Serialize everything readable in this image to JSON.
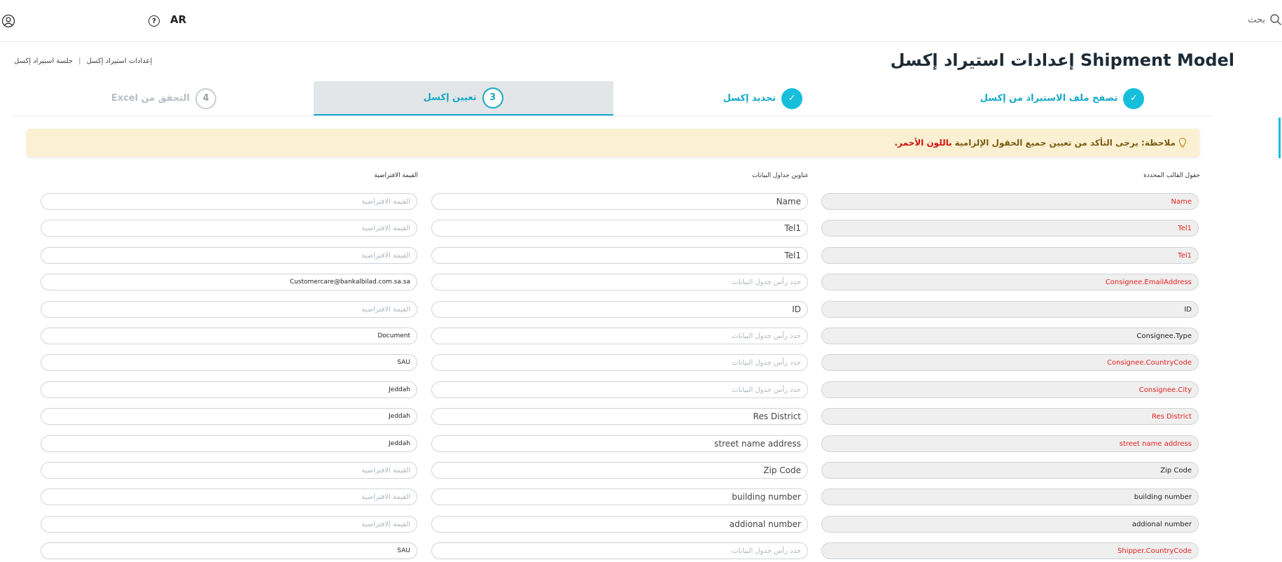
{
  "topbar": {
    "language": "AR",
    "help_glyph": "?",
    "search_label": "بحث",
    "icons": {
      "user": "user-circle-icon",
      "help": "help-circle-icon",
      "search": "search-icon"
    }
  },
  "page": {
    "title": "Shipment Model إعدادات استيراد إكسل"
  },
  "breadcrumb": {
    "items": [
      "إعدادات استيراد إكسل",
      "جلسة استيراد إكسل"
    ],
    "separator": "|"
  },
  "steps": [
    {
      "label": "تصفح ملف الاستيراد من إكسل",
      "state": "done",
      "marker": "✓"
    },
    {
      "label": "تحديد إكسل",
      "state": "done",
      "marker": "✓"
    },
    {
      "label": "تعيين إكسل",
      "state": "active",
      "marker": "3"
    },
    {
      "label": "التحقق من Excel",
      "state": "pending",
      "marker": "4"
    }
  ],
  "note": {
    "text": "ملاحظة: يرجى التأكد من تعيين جميع الحقول الإلزامية",
    "red_text": "باللون الأحمر."
  },
  "columns": {
    "template": "حقول القالب المحددة",
    "header": "عناوين جداول البيانات",
    "default": "القيمة الافتراضية"
  },
  "placeholders": {
    "header": "حدد رأس جدول البيانات",
    "default": "القيمة الافتراضية"
  },
  "rows": [
    {
      "template": "Name",
      "required": true,
      "header": "Name",
      "default": ""
    },
    {
      "template": "Tel1",
      "required": true,
      "header": "Tel1",
      "default": ""
    },
    {
      "template": "Tel1",
      "required": true,
      "header": "Tel1",
      "default": ""
    },
    {
      "template": "Consignee.EmailAddress",
      "required": true,
      "header": "",
      "default": "Customercare@bankalbilad.com.sa.sa"
    },
    {
      "template": "ID",
      "required": false,
      "header": "ID",
      "default": ""
    },
    {
      "template": "Consignee.Type",
      "required": false,
      "header": "",
      "default": "Document"
    },
    {
      "template": "Consignee.CountryCode",
      "required": true,
      "header": "",
      "default": "SAU"
    },
    {
      "template": "Consignee.City",
      "required": true,
      "header": "",
      "default": "Jeddah"
    },
    {
      "template": "Res District",
      "required": true,
      "header": "Res District",
      "default": "Jeddah"
    },
    {
      "template": "street name address",
      "required": true,
      "header": "street name address",
      "default": "Jeddah"
    },
    {
      "template": "Zip Code",
      "required": false,
      "header": "Zip Code",
      "default": ""
    },
    {
      "template": "building number",
      "required": false,
      "header": "building number",
      "default": ""
    },
    {
      "template": "addional number",
      "required": false,
      "header": "addional number",
      "default": ""
    },
    {
      "template": "Shipper.CountryCode",
      "required": true,
      "header": "",
      "default": "SAU"
    }
  ],
  "colors": {
    "accent": "#15bfdc",
    "required": "#e32020",
    "note_bg": "#fcf0d2"
  }
}
